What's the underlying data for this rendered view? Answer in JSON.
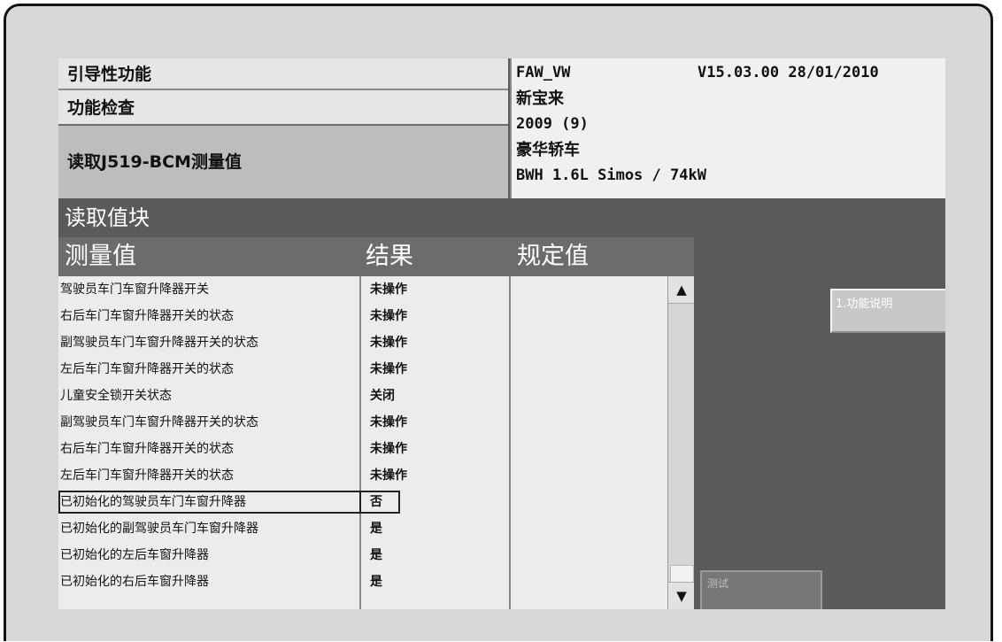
{
  "header_left": {
    "line1": "引导性功能",
    "line2": "功能检查",
    "line3": "读取J519-BCM测量值"
  },
  "header_right": {
    "brand": "FAW_VW",
    "version": "V15.03.00 28/01/2010",
    "model": "新宝来",
    "year": "2009 (9)",
    "body": "豪华轿车",
    "engine": "BWH 1.6L Simos / 74kW"
  },
  "section_title": "读取值块",
  "columns": {
    "measurement": "测量值",
    "result": "结果",
    "spec": "规定值"
  },
  "rows": [
    {
      "name": "驾驶员车门车窗升降器开关",
      "value": "未操作"
    },
    {
      "name": "右后车门车窗升降器开关的状态",
      "value": "未操作"
    },
    {
      "name": "副驾驶员车门车窗升降器开关的状态",
      "value": "未操作"
    },
    {
      "name": "左后车门车窗升降器开关的状态",
      "value": "未操作"
    },
    {
      "name": "儿童安全锁开关状态",
      "value": "关闭"
    },
    {
      "name": "副驾驶员车门车窗升降器开关的状态",
      "value": "未操作"
    },
    {
      "name": "右后车门车窗升降器开关的状态",
      "value": "未操作"
    },
    {
      "name": "左后车门车窗升降器开关的状态",
      "value": "未操作"
    },
    {
      "name": "已初始化的驾驶员车门车窗升降器",
      "value": "否"
    },
    {
      "name": "已初始化的副驾驶员车门车窗升降器",
      "value": "是"
    },
    {
      "name": "已初始化的左后车窗升降器",
      "value": "是"
    },
    {
      "name": "已初始化的右后车窗升降器",
      "value": "是"
    }
  ],
  "buttons": {
    "function_desc": "1.功能说明",
    "test": "测试"
  },
  "scroll": {
    "up": "▲",
    "down": "▼"
  }
}
